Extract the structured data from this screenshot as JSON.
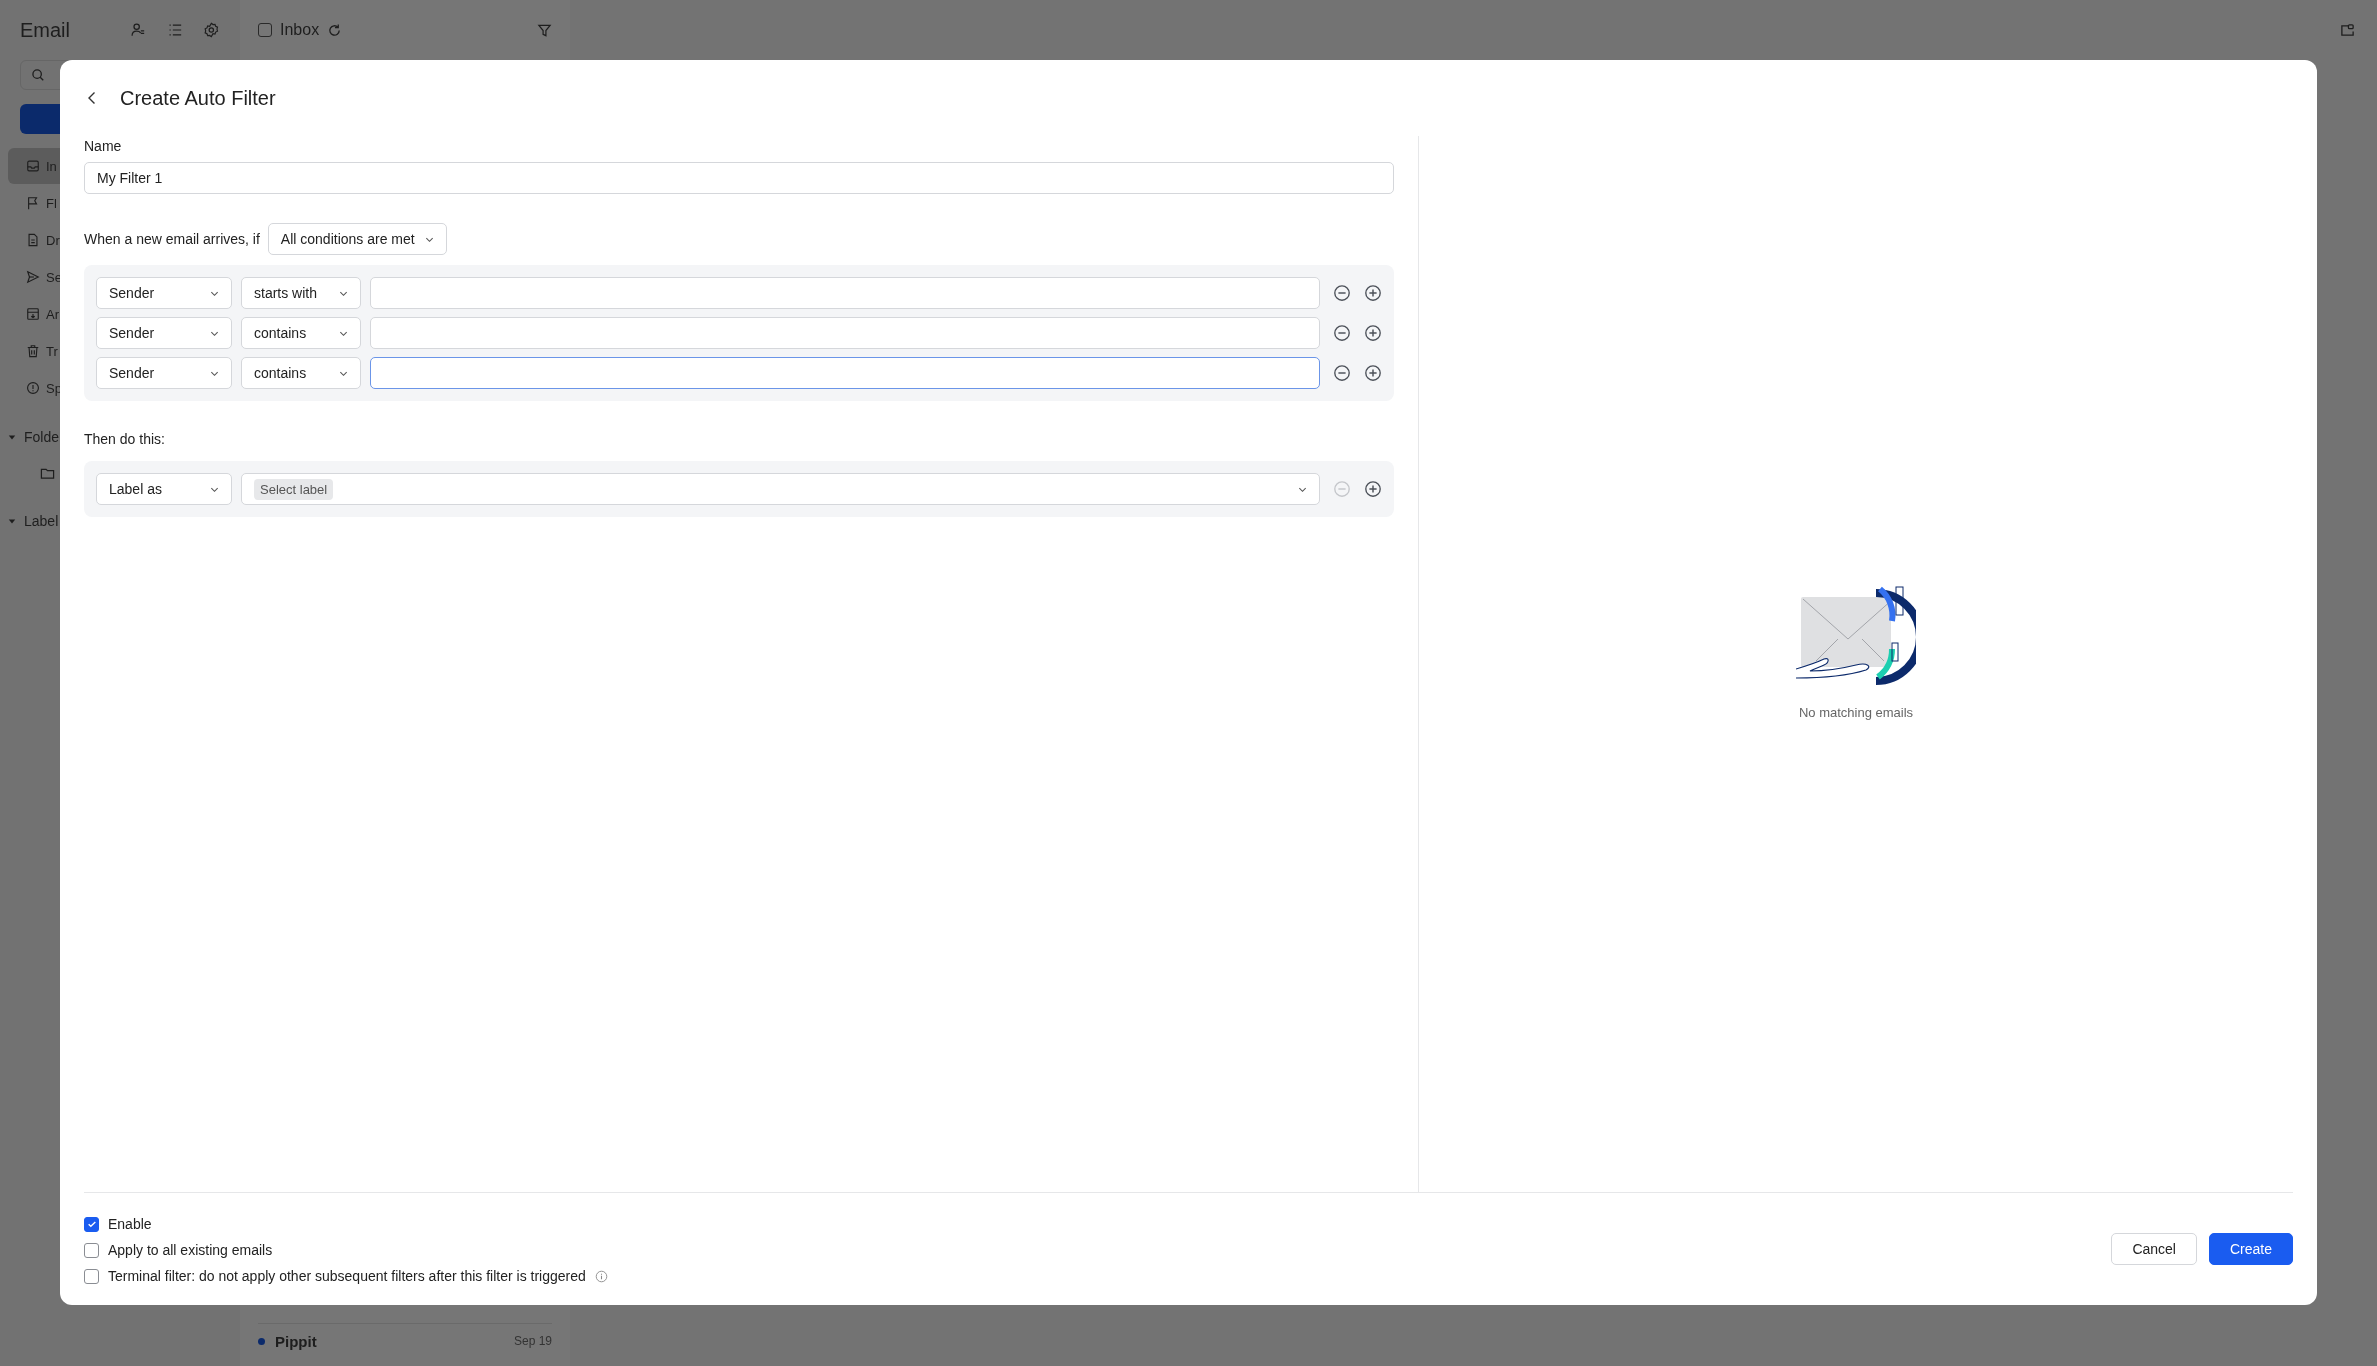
{
  "app": {
    "title": "Email",
    "inbox_label": "Inbox",
    "inbox_checked": false,
    "nav": [
      {
        "label": "In",
        "selected": true
      },
      {
        "label": "Fl",
        "selected": false
      },
      {
        "label": "Dr",
        "selected": false
      },
      {
        "label": "Se",
        "selected": false
      },
      {
        "label": "Ar",
        "selected": false
      },
      {
        "label": "Tr",
        "selected": false
      },
      {
        "label": "Sp",
        "selected": false
      }
    ],
    "sections": [
      {
        "label": "Folde",
        "expanded": true
      },
      {
        "label": "Label",
        "expanded": true
      }
    ],
    "messages": [
      {
        "sender": "Pippit",
        "date": "Sep 19",
        "unread": true
      }
    ]
  },
  "dialog": {
    "title": "Create Auto Filter",
    "name_label": "Name",
    "name_value": "My Filter 1",
    "match_prompt": "When a new email arrives, if",
    "match_mode": "All conditions are met",
    "conditions": [
      {
        "field": "Sender",
        "operator": "starts with",
        "focused": false,
        "remove_disabled": false
      },
      {
        "field": "Sender",
        "operator": "contains",
        "focused": false,
        "remove_disabled": false
      },
      {
        "field": "Sender",
        "operator": "contains",
        "focused": true,
        "remove_disabled": false
      }
    ],
    "action_heading": "Then do this:",
    "actions": [
      {
        "action": "Label as",
        "placeholder": "Select label",
        "remove_disabled": true
      }
    ],
    "preview_message": "No matching emails",
    "options": [
      {
        "label": "Enable",
        "checked": true,
        "info": false
      },
      {
        "label": "Apply to all existing emails",
        "checked": false,
        "info": false
      },
      {
        "label": "Terminal filter: do not apply other subsequent filters after this filter is triggered",
        "checked": false,
        "info": true
      }
    ],
    "buttons": [
      {
        "label": "Cancel",
        "kind": "secondary"
      },
      {
        "label": "Create",
        "kind": "primary"
      }
    ]
  }
}
